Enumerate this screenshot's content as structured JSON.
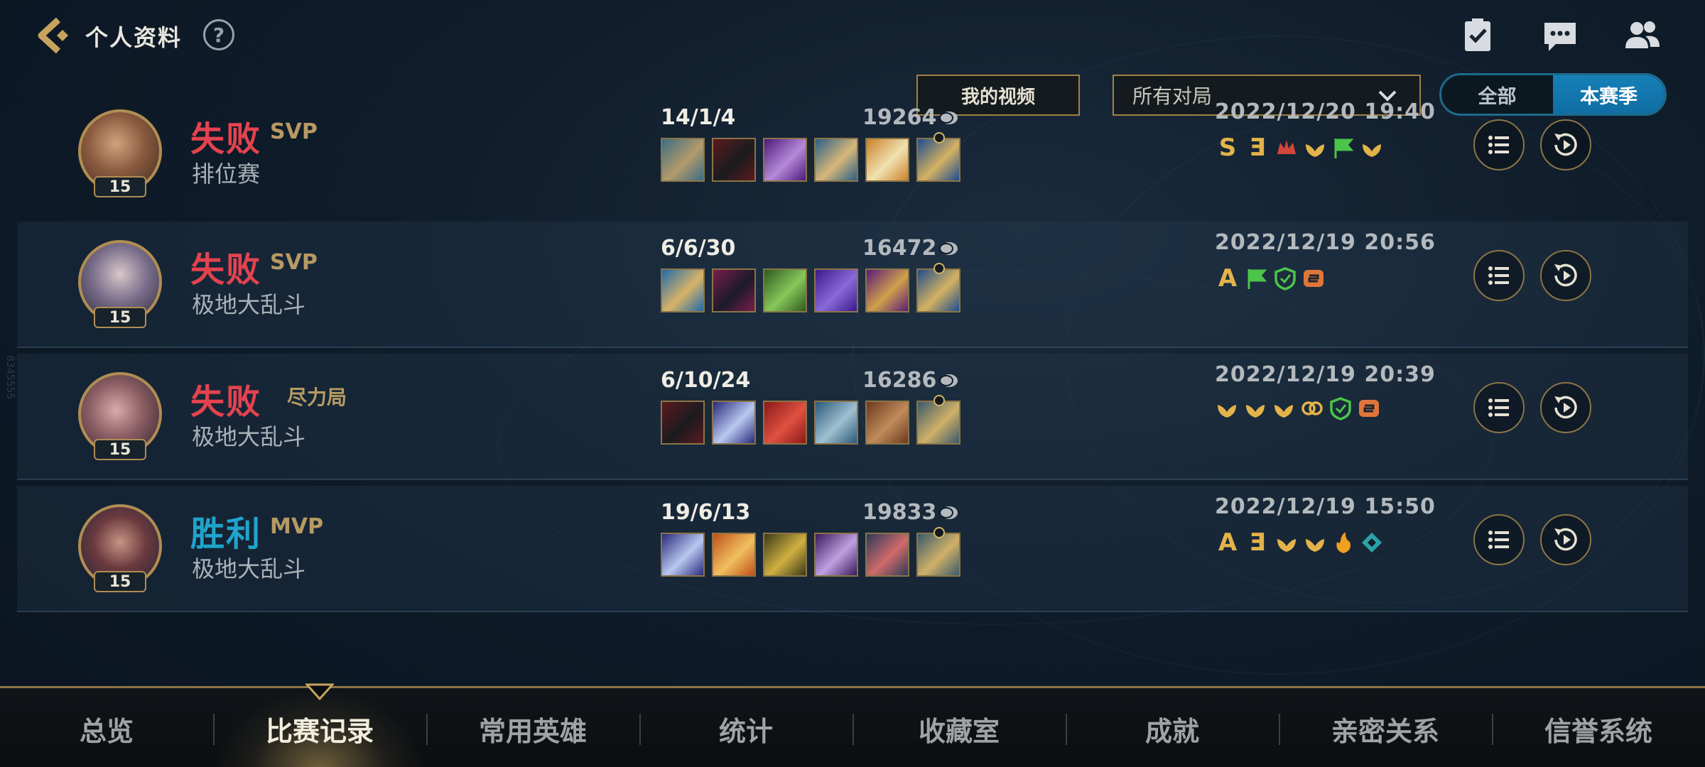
{
  "header": {
    "title": "个人资料",
    "help_label": "?"
  },
  "filters": {
    "my_video_label": "我的视频",
    "match_filter_value": "所有对局",
    "season_toggle": {
      "all_label": "全部",
      "season_label": "本赛季",
      "selected": "本赛季"
    }
  },
  "side_id": "8345555",
  "matches": [
    {
      "result": "失败",
      "result_color": "#e3434f",
      "badge": "SVP",
      "mode": "排位赛",
      "level": "15",
      "kda": "14/1/4",
      "gold": "19264",
      "datetime": "2022/12/20 19:40",
      "honors": [
        "S",
        "Ǝ",
        "crown",
        "wings",
        "flag",
        "wings"
      ],
      "items": [
        {
          "name": "hammer-item",
          "c1": "#3a6d84",
          "c2": "#b49a6b"
        },
        {
          "name": "blade-item",
          "c1": "#5a1a1e",
          "c2": "#1b1b1f"
        },
        {
          "name": "purple-blade-item",
          "c1": "#4b1a7a",
          "c2": "#b68ad8"
        },
        {
          "name": "spear-item",
          "c1": "#2b5f86",
          "c2": "#d7b77a"
        },
        {
          "name": "wings-item",
          "c1": "#c9812a",
          "c2": "#f0e2b1"
        },
        {
          "name": "trinket-item",
          "c1": "#1f4c8c",
          "c2": "#d4b262"
        }
      ]
    },
    {
      "result": "失败",
      "result_color": "#e3434f",
      "badge": "SVP",
      "mode": "极地大乱斗",
      "level": "15",
      "kda": "6/6/30",
      "gold": "16472",
      "datetime": "2022/12/19 20:56",
      "honors": [
        "A",
        "flag",
        "shield",
        "chain"
      ],
      "items": [
        {
          "name": "trident-item",
          "c1": "#1f6aa8",
          "c2": "#d9b368"
        },
        {
          "name": "cloak-item",
          "c1": "#7a1e4a",
          "c2": "#1a1a2a"
        },
        {
          "name": "claw-item",
          "c1": "#2f5a1e",
          "c2": "#86c85a"
        },
        {
          "name": "staff-item",
          "c1": "#3a1a8a",
          "c2": "#8a6ad8"
        },
        {
          "name": "lamp-item",
          "c1": "#5a1a7a",
          "c2": "#d0a04a"
        },
        {
          "name": "trinket-item",
          "c1": "#1f4c8c",
          "c2": "#d4b262"
        }
      ]
    },
    {
      "result": "失败",
      "result_color": "#e3434f",
      "badge": "尽力局",
      "mode": "极地大乱斗",
      "level": "15",
      "kda": "6/10/24",
      "gold": "16286",
      "datetime": "2022/12/19 20:39",
      "honors": [
        "wings",
        "wings",
        "wings",
        "link",
        "shield",
        "chain"
      ],
      "items": [
        {
          "name": "blade-item",
          "c1": "#5a1a1e",
          "c2": "#1b1b1f"
        },
        {
          "name": "shuriken-item",
          "c1": "#2a2a7a",
          "c2": "#b8c8f0"
        },
        {
          "name": "gauntlet-item",
          "c1": "#8a1a1a",
          "c2": "#e05040"
        },
        {
          "name": "armor-item",
          "c1": "#2a5a7a",
          "c2": "#a0c0d0"
        },
        {
          "name": "hammer-item",
          "c1": "#6a3a1e",
          "c2": "#c08a5a"
        },
        {
          "name": "chestplate-item",
          "c1": "#3a5a6a",
          "c2": "#d0b068"
        }
      ]
    },
    {
      "result": "胜利",
      "result_color": "#1fa4cc",
      "badge": "MVP",
      "mode": "极地大乱斗",
      "level": "15",
      "kda": "19/6/13",
      "gold": "19833",
      "datetime": "2022/12/19 15:50",
      "honors": [
        "A",
        "Ǝ",
        "wings",
        "wings",
        "fire",
        "diamond"
      ],
      "items": [
        {
          "name": "shuriken-item",
          "c1": "#2a2a7a",
          "c2": "#b8c8f0"
        },
        {
          "name": "orb-staff-item",
          "c1": "#c0501a",
          "c2": "#f0c060"
        },
        {
          "name": "dagger-item",
          "c1": "#3a3a1a",
          "c2": "#d0b040"
        },
        {
          "name": "glaive-item",
          "c1": "#3a1a5a",
          "c2": "#c0a0e0"
        },
        {
          "name": "sword-item",
          "c1": "#2a3a5a",
          "c2": "#d06a6a"
        },
        {
          "name": "chestplate-item",
          "c1": "#3a5a6a",
          "c2": "#d0b068"
        }
      ]
    }
  ],
  "tabs": [
    "总览",
    "比赛记录",
    "常用英雄",
    "统计",
    "收藏室",
    "成就",
    "亲密关系",
    "信誉系统"
  ],
  "active_tab": "比赛记录"
}
